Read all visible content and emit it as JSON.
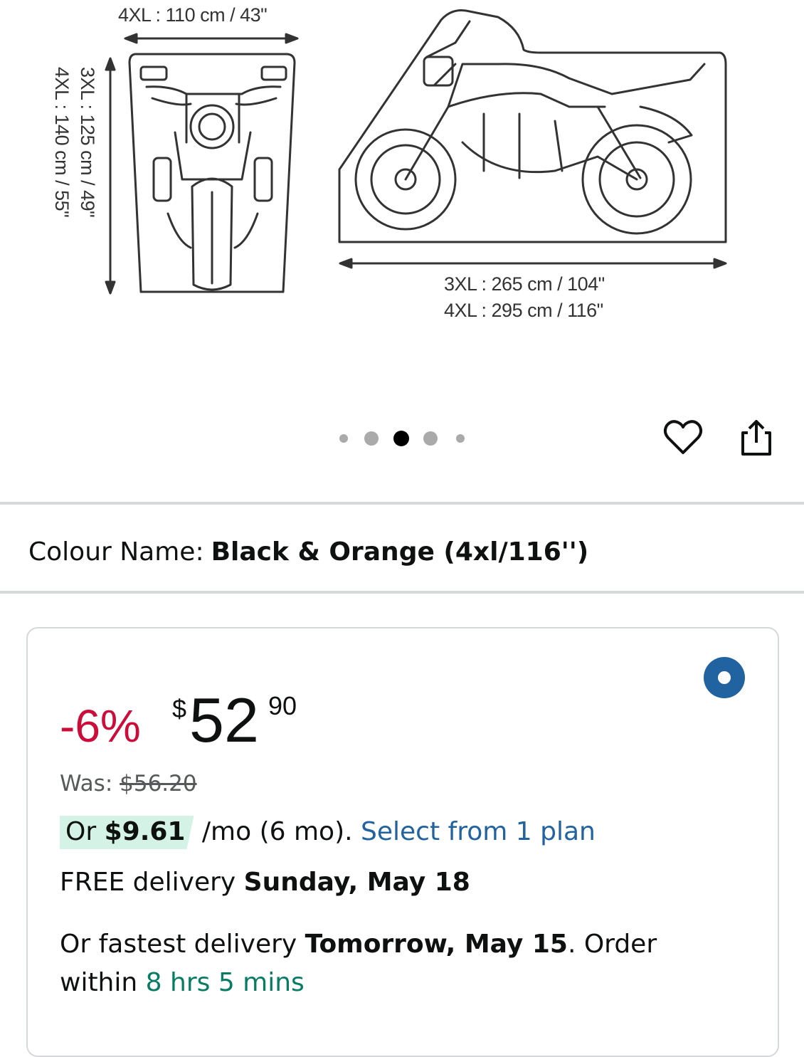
{
  "image": {
    "top_view_width_label": "4XL : 110 cm / 43\"",
    "top_view_height_label_1": "3XL : 125 cm / 49\"",
    "top_view_height_label_2": "4XL : 140 cm / 55\"",
    "side_view_length_label_1": "3XL : 265 cm / 104\"",
    "side_view_length_label_2": "4XL : 295 cm / 116\""
  },
  "carousel": {
    "total_slides": 5,
    "active_index": 2
  },
  "actions": {
    "wishlist_icon": "heart-icon",
    "share_icon": "share-icon"
  },
  "colour": {
    "label": "Colour Name:",
    "value": "Black & Orange (4xl/116'')"
  },
  "offer": {
    "selected": true,
    "discount": "-6%",
    "currency": "$",
    "price_whole": "52",
    "price_fraction": "90",
    "was_label": "Was:",
    "was_price": "$56.20",
    "plan_prefix": "Or",
    "plan_amount": "$9.61",
    "plan_terms": "/mo (6 mo).",
    "plan_link": "Select from 1 plan",
    "delivery_prefix": "FREE delivery",
    "delivery_date": "Sunday, May 18",
    "fastest_prefix": "Or fastest delivery",
    "fastest_date": "Tomorrow, May 15",
    "fastest_mid": ". Order within",
    "fastest_countdown": "8 hrs 5 mins"
  },
  "colors": {
    "discount": "#cc0c39",
    "link": "#2162a1",
    "countdown": "#067d62",
    "plan_highlight": "#d4f3e6",
    "radio": "#2162a1"
  }
}
